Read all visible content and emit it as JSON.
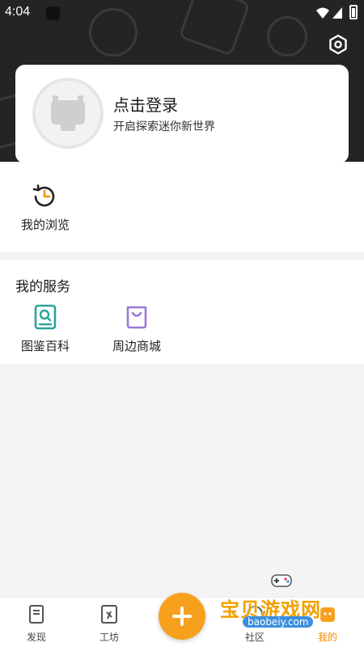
{
  "status_bar": {
    "time": "4:04"
  },
  "login": {
    "title": "点击登录",
    "subtitle": "开启探索迷你新世界"
  },
  "browse": {
    "label": "我的浏览"
  },
  "services": {
    "title": "我的服务",
    "items": [
      {
        "label": "图鉴百科",
        "icon": "book-search-icon"
      },
      {
        "label": "周边商城",
        "icon": "shopping-bag-icon"
      }
    ]
  },
  "tabs": [
    {
      "label": "发现",
      "icon": "discover-icon"
    },
    {
      "label": "工坊",
      "icon": "workshop-icon"
    },
    {
      "label": "社区",
      "icon": "community-icon"
    },
    {
      "label": "我的",
      "icon": "profile-icon",
      "active": true
    }
  ],
  "watermark": {
    "title": "宝贝游戏网",
    "url": "baobeiy.com"
  },
  "colors": {
    "accent": "#f7a01e",
    "header_bg": "#242424",
    "teal": "#2aa39a",
    "purple": "#9b79d8"
  }
}
